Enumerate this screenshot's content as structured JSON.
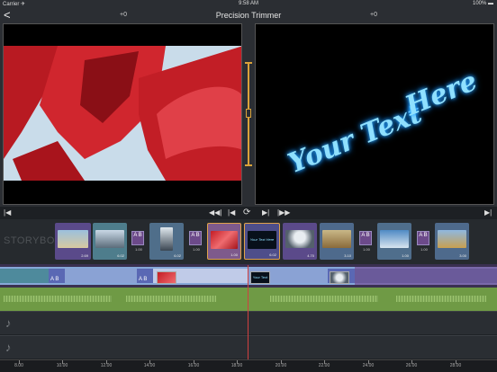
{
  "status": {
    "carrier": "Carrier ✈",
    "time": "9:58 AM",
    "battery": "100% ▬"
  },
  "nav": {
    "back": "<",
    "title": "Precision Trimmer",
    "left_offset": "+0",
    "right_offset": "+0"
  },
  "viewer_right": {
    "text_line1": "Your Text",
    "text_line2": "Here"
  },
  "transport": {
    "to_start": "|◀",
    "prev_frame": "◀◀|",
    "step_back": "|◀",
    "loop": "⟳",
    "step_fwd": "▶|",
    "next_frame": "|▶▶",
    "to_end": "▶|"
  },
  "storyboard": {
    "label": "STORYBOARD",
    "clips": [
      {
        "dur": "2.69"
      },
      {
        "dur": "6.02"
      },
      {
        "dur": "6.02"
      },
      {
        "dur": "1.00"
      },
      {
        "dur": "6.02"
      },
      {
        "dur": "4.70"
      },
      {
        "dur": "3.10"
      },
      {
        "dur": "1.00"
      },
      {
        "dur": "3.00"
      },
      {
        "dur": "3.00"
      }
    ],
    "transitions": [
      {
        "label": "A B",
        "dur": "1.00"
      },
      {
        "label": "A B",
        "dur": "1.00"
      },
      {
        "label": "A B",
        "dur": "1.00"
      },
      {
        "label": "A B",
        "dur": "1.00"
      },
      {
        "label": "A B",
        "dur": "1.00"
      }
    ],
    "mini_label": "Your Text Here"
  },
  "timeline": {
    "transition_label": "A B",
    "video_text": "Your Text Here",
    "ruler": [
      "8.00",
      "10.00",
      "12.00",
      "14.00",
      "16.00",
      "18.00",
      "20.00",
      "22.00",
      "24.00",
      "26.00",
      "28.00"
    ]
  },
  "icons": {
    "music": "♪"
  }
}
